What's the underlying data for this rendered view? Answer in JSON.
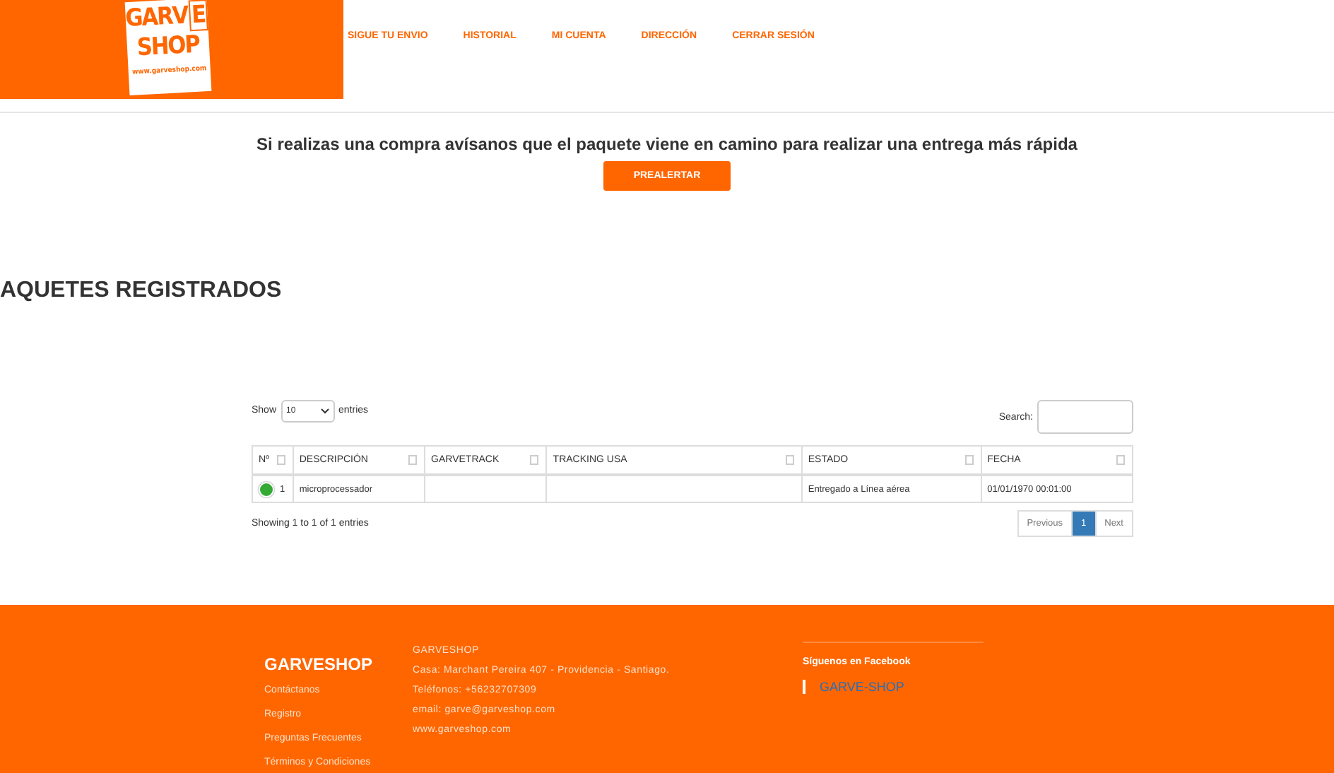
{
  "logo": {
    "line1": "GARV",
    "line1_box": "E",
    "line2": "SHOP",
    "url": "www.garveshop.com"
  },
  "nav": [
    "SIGUE TU ENVIO",
    "HISTORIAL",
    "MI CUENTA",
    "DIRECCIÓN",
    "CERRAR SESIÓN"
  ],
  "notice": {
    "text": "Si realizas una compra avísanos que el paquete viene en camino para realizar una entrega más rápida",
    "button": "PREALERTAR"
  },
  "section_title": "AQUETES REGISTRADOS",
  "table": {
    "length_label_before": "Show",
    "length_value": "10",
    "length_label_after": "entries",
    "search_label": "Search:",
    "columns": [
      "Nº",
      "DESCRIPCIÓN",
      "GARVETRACK",
      "TRACKING USA",
      "ESTADO",
      "FECHA"
    ],
    "rows": [
      {
        "expanded": false,
        "cells": [
          "1",
          "microprocessador",
          "",
          "",
          "Entregado a Línea aérea",
          "01/01/1970 00:01:00"
        ]
      }
    ],
    "info": "Showing 1 to 1 of 1 entries",
    "pagination": [
      {
        "label": "Previous",
        "selected": false
      },
      {
        "label": "1",
        "selected": true
      },
      {
        "label": "Next",
        "selected": false
      }
    ]
  },
  "footer": {
    "brand": "GARVESHOP",
    "links": [
      "Contáctanos",
      "Registro",
      "Preguntas Frecuentes",
      "Términos y Condiciones"
    ],
    "contact": [
      "GARVESHOP",
      "Casa: Marchant Pereira 407 - Providencia - Santiago.",
      "Teléfonos: +56232707309",
      "email: garve@garveshop.com",
      "www.garveshop.com"
    ],
    "social_title": "Síguenos en Facebook",
    "social_link": "GARVE-SHOP"
  }
}
